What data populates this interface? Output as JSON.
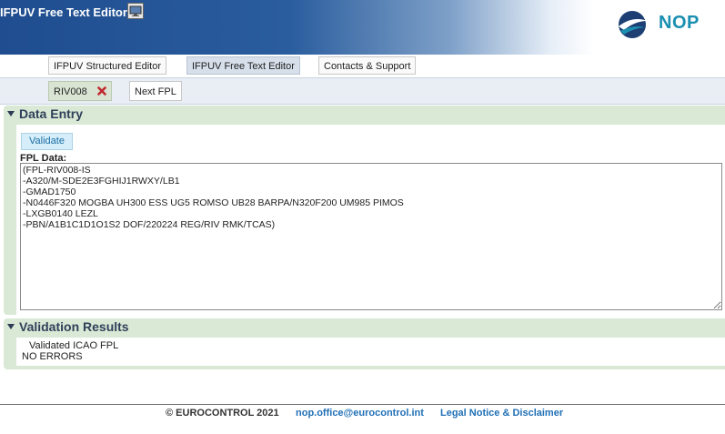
{
  "header": {
    "title": "IFPUV Free Text Editor",
    "logo_text": "NOP",
    "brand_color": "#1a8fb0"
  },
  "tabs": [
    {
      "label": "IFPUV Structured Editor"
    },
    {
      "label": "IFPUV Free Text Editor",
      "active": true
    },
    {
      "label": "Contacts & Support"
    }
  ],
  "subtabs": [
    {
      "label": "RIV008",
      "active": true
    },
    {
      "label": "Next FPL"
    }
  ],
  "data_entry": {
    "heading": "Data Entry",
    "validate_label": "Validate",
    "fpl_label": "FPL Data:",
    "fpl_value": "(FPL-RIV008-IS\n-A320/M-SDE2E3FGHIJ1RWXY/LB1\n-GMAD1750\n-N0446F320 MOGBA UH300 ESS UG5 ROMSO UB28 BARPA/N320F200 UM985 PIMOS\n-LXGB0140 LEZL\n-PBN/A1B1C1D1O1S2 DOF/220224 REG/RIV RMK/TCAS)"
  },
  "validation": {
    "heading": "Validation Results",
    "title": "Validated ICAO FPL",
    "status": "NO ERRORS"
  },
  "footer": {
    "copyright": "© EUROCONTROL 2021",
    "email": "nop.office@eurocontrol.int",
    "legal": "Legal Notice & Disclaimer"
  }
}
